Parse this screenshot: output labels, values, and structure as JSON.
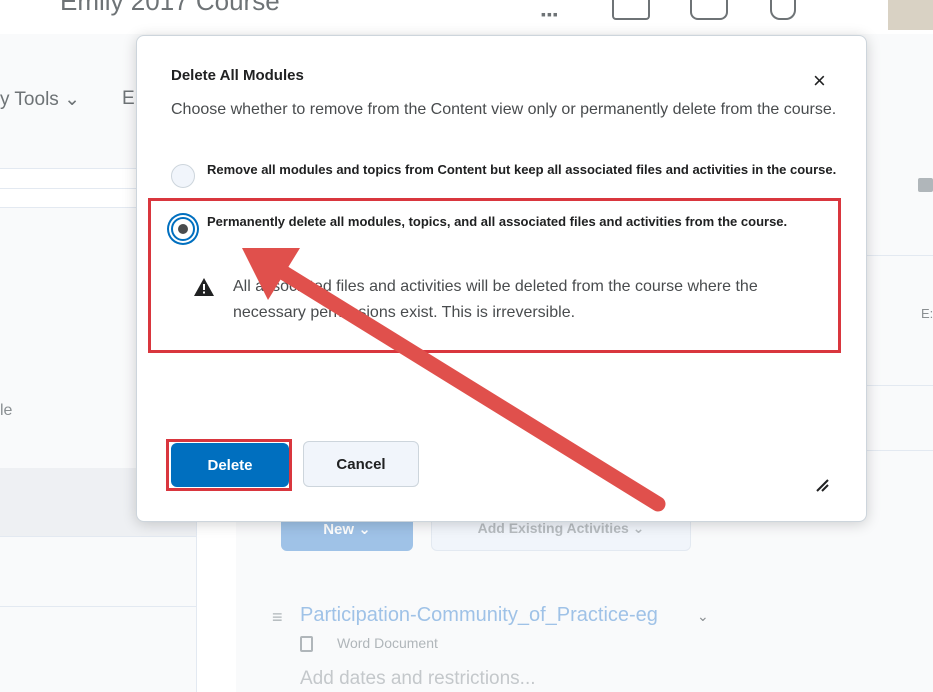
{
  "background": {
    "course_title": "Emily 2017 Course",
    "nav_items": [
      "y Tools ⌄",
      "E"
    ],
    "left_partial_text": "le",
    "right_partial_text": "E:",
    "new_button": "New ⌄",
    "add_existing_button": "Add Existing Activities ⌄",
    "topic": {
      "title": "Participation-Community_of_Practice-eg",
      "type": "Word Document",
      "add_dates": "Add dates and restrictions..."
    }
  },
  "modal": {
    "title": "Delete All Modules",
    "close": "×",
    "description": "Choose whether to remove from the Content view only or permanently delete from the course.",
    "options": [
      {
        "label": "Remove all modules and topics from Content but keep all associated files and activities in the course.",
        "selected": false
      },
      {
        "label": "Permanently delete all modules, topics, and all associated files and activities from the course.",
        "selected": true
      }
    ],
    "warning": "All associated files and activities will be deleted from the course where the necessary permissions exist. This is irreversible.",
    "delete_button": "Delete",
    "cancel_button": "Cancel"
  },
  "colors": {
    "primary": "#006fbf",
    "annotation_red": "#d9363e"
  },
  "icons": [
    "grid-icon",
    "mail-icon",
    "chat-icon",
    "bell-icon",
    "search-icon",
    "print-icon",
    "close-icon",
    "warning-icon",
    "resize-icon",
    "document-icon",
    "drag-handle-icon",
    "chevron-down-icon",
    "annotation-arrow"
  ]
}
